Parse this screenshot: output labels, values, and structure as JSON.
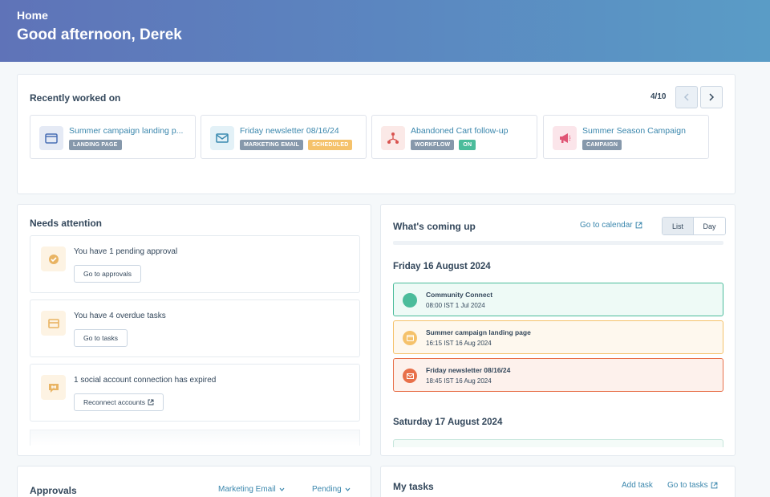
{
  "header": {
    "breadcrumb": "Home",
    "greeting": "Good afternoon, Derek",
    "gradient_start": "#5f73b8",
    "gradient_end": "#5a9cc6"
  },
  "recent": {
    "title": "Recently worked on",
    "pager": "4/10",
    "items": [
      {
        "title": "Summer campaign landing p...",
        "icon": "landing-page-icon",
        "tags": [
          {
            "label": "LANDING PAGE",
            "color": "gray"
          }
        ]
      },
      {
        "title": "Friday newsletter 08/16/24",
        "icon": "email-icon",
        "tags": [
          {
            "label": "MARKETING EMAIL",
            "color": "gray"
          },
          {
            "label": "SCHEDULED",
            "color": "orange"
          }
        ]
      },
      {
        "title": "Abandoned Cart follow-up",
        "icon": "workflow-icon",
        "tags": [
          {
            "label": "WORKFLOW",
            "color": "gray"
          },
          {
            "label": "ON",
            "color": "green"
          }
        ]
      },
      {
        "title": "Summer Season Campaign",
        "icon": "megaphone-icon",
        "tags": [
          {
            "label": "CAMPAIGN",
            "color": "gray"
          }
        ]
      }
    ]
  },
  "attention": {
    "title": "Needs attention",
    "items": [
      {
        "text": "You have 1 pending approval",
        "button": "Go to approvals",
        "icon": "check-badge-icon",
        "external": false
      },
      {
        "text": "You have 4 overdue tasks",
        "button": "Go to tasks",
        "icon": "task-icon",
        "external": false
      },
      {
        "text": "1 social account connection has expired",
        "button": "Reconnect accounts",
        "icon": "social-icon",
        "external": true
      }
    ]
  },
  "coming": {
    "title": "What's coming up",
    "calendar_link": "Go to calendar",
    "view_list": "List",
    "view_day": "Day",
    "days": [
      {
        "label": "Friday 16 August 2024",
        "events": [
          {
            "title": "Community Connect",
            "time": "08:00 IST 1 Jul 2024",
            "color": "#4bbc9b",
            "bg": "#eefaf6"
          },
          {
            "title": "Summer campaign landing page",
            "time": "16:15 IST 16 Aug 2024",
            "color": "#f5c26b",
            "bg": "#fef8ee"
          },
          {
            "title": "Friday newsletter 08/16/24",
            "time": "18:45 IST 16 Aug 2024",
            "color": "#e8704a",
            "bg": "#fdf1ec"
          }
        ]
      },
      {
        "label": "Saturday 17 August 2024",
        "events": []
      }
    ]
  },
  "approvals": {
    "title": "Approvals",
    "filter_type": "Marketing Email",
    "filter_status": "Pending"
  },
  "tasks": {
    "title": "My tasks",
    "add": "Add task",
    "go": "Go to tasks"
  }
}
